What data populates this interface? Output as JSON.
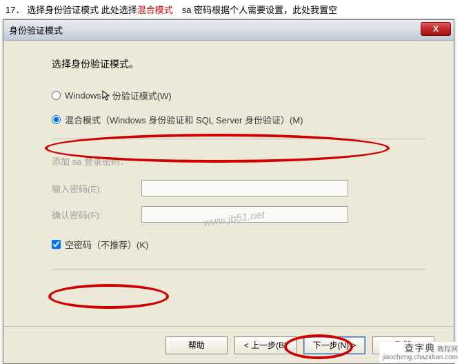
{
  "caption": {
    "num": "17．",
    "prefix": "选择身份验证模式  此处选择",
    "highlight": "混合模式",
    "suffix": "　sa 密码根据个人需要设置，此处我置空"
  },
  "dialog": {
    "title": "身份验证模式",
    "close": "X"
  },
  "body": {
    "heading": "选择身份验证模式。",
    "radio1": "Windows 身份验证模式(W)",
    "radio1_pre": "Windows ",
    "radio1_post": "份验证模式(W)",
    "radio2": "混合模式（Windows 身份验证和 SQL Server 身份验证）(M)",
    "section": "添加 sa 登录密码：",
    "field1": "输入密码(E):",
    "field2": "确认密码(F):",
    "checkbox": "空密码（不推荐）(K)"
  },
  "footer": {
    "help": "帮助",
    "back": "< 上一步(B)",
    "next": "下一步(N) >",
    "cancel": "取消"
  },
  "watermark": "www.jb51.net",
  "corner": {
    "brand": "查字典",
    "sub": "教程网",
    "url": "jiaocheng.chazidian.com"
  }
}
